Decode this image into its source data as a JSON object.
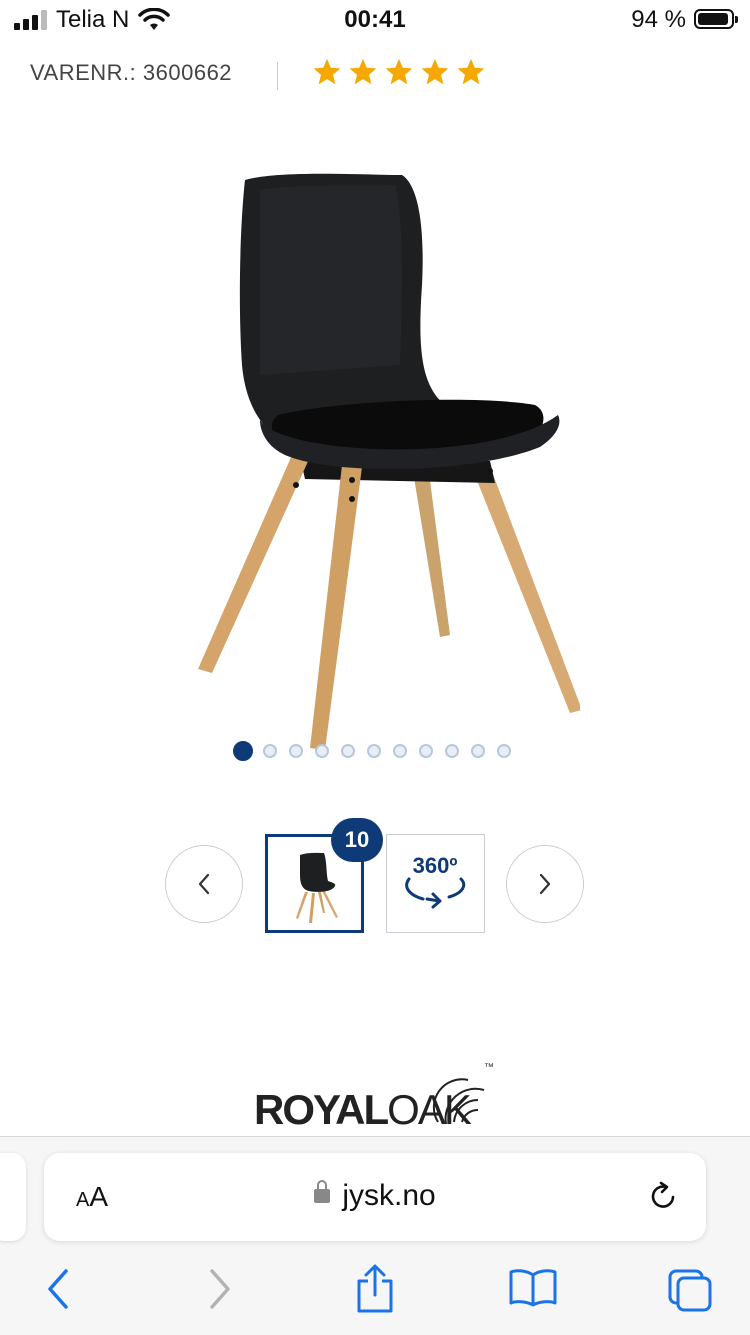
{
  "status_bar": {
    "carrier": "Telia N",
    "time": "00:41",
    "battery_percent": "94 %",
    "battery_level": 0.94
  },
  "product": {
    "sku_label": "VARENR.: 3600662",
    "rating_stars": 5,
    "star_color": "#f5a800",
    "image_count_badge": "10",
    "gallery_total": 11,
    "gallery_active": 1,
    "thumb_360_label": "360º"
  },
  "brand": {
    "royal": "ROYAL",
    "oak": "OAK",
    "tm": "™"
  },
  "browser": {
    "aa_label_small": "A",
    "aa_label_big": "A",
    "url": "jysk.no"
  },
  "colors": {
    "accent": "#0f3a78",
    "safari_blue": "#1a73e8"
  }
}
